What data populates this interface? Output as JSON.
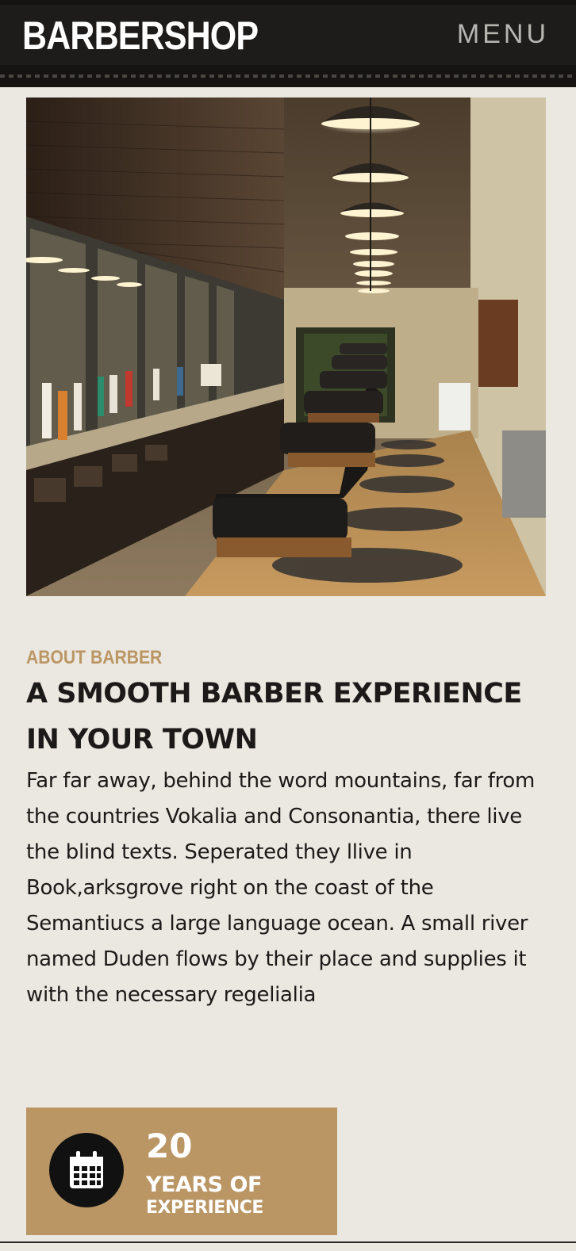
{
  "header": {
    "brand": "BARBERSHOP",
    "menu_label": "MENU"
  },
  "hero": {
    "image_alt": "Barbershop interior with rows of barber chairs and mirrors"
  },
  "about": {
    "eyebrow": "ABOUT BARBER",
    "headline": "A SMOOTH BARBER EXPERIENCE IN YOUR TOWN",
    "paragraph": "Far far away, behind the word mountains, far from the countries Vokalia and Consonantia, there live the blind texts. Seperated they llive in Book,arksgrove right on the coast of the Semantiucs a large language ocean. A small river named Duden flows by their place and supplies it with the necessary regelialia"
  },
  "experience": {
    "icon": "calendar-icon",
    "number": "20",
    "label_line1": "YEARS OF",
    "label_line2": "EXPERIENCE"
  },
  "colors": {
    "accent": "#bb9665",
    "header_bg": "#1d1c1a",
    "page_bg": "#ebe8e1",
    "text_dark": "#1b1a18"
  }
}
